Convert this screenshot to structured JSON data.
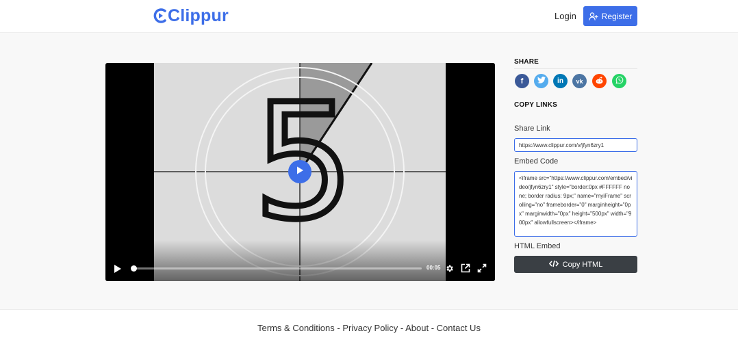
{
  "header": {
    "logo_text": "Clippur",
    "login_label": "Login",
    "register_label": "Register",
    "brand_color": "#3d6ee8"
  },
  "player": {
    "countdown_digit": "5",
    "time": "00:05",
    "progress_fraction": 0.0,
    "icons": [
      "play-icon",
      "settings-icon",
      "picture-in-picture-icon",
      "fullscreen-icon"
    ]
  },
  "share": {
    "title": "SHARE",
    "networks": [
      {
        "name": "facebook",
        "glyph": "f",
        "color": "#3b5998"
      },
      {
        "name": "twitter",
        "glyph": "t",
        "color": "#55acee"
      },
      {
        "name": "linkedin",
        "glyph": "in",
        "color": "#0077b5"
      },
      {
        "name": "vk",
        "glyph": "vk",
        "color": "#4c75a3"
      },
      {
        "name": "reddit",
        "glyph": "r",
        "color": "#ff4500"
      },
      {
        "name": "whatsapp",
        "glyph": "w",
        "color": "#25d366"
      }
    ]
  },
  "copy_links": {
    "title": "COPY LINKS",
    "share_link_label": "Share Link",
    "share_link_value": "https://www.clippur.com/v/jfyn6zry1",
    "embed_label": "Embed Code",
    "embed_value": "<iframe src=\"https://www.clippur.com/embed/video/jfyn6zry1\" style=\"border:0px #FFFFFF none; border radius: 9px;\" name=\"myiFrame\" scrolling=\"no\" frameborder=\"0\" marginheight=\"0px\" marginwidth=\"0px\" height=\"500px\" width=\"900px\" allowfullscreen></iframe>",
    "html_embed_label": "HTML Embed",
    "copy_html_label": "Copy HTML"
  },
  "footer": {
    "terms": "Terms & Conditions",
    "privacy": "Privacy Policy",
    "about": "About",
    "contact": "Contact Us",
    "separator": " - "
  }
}
